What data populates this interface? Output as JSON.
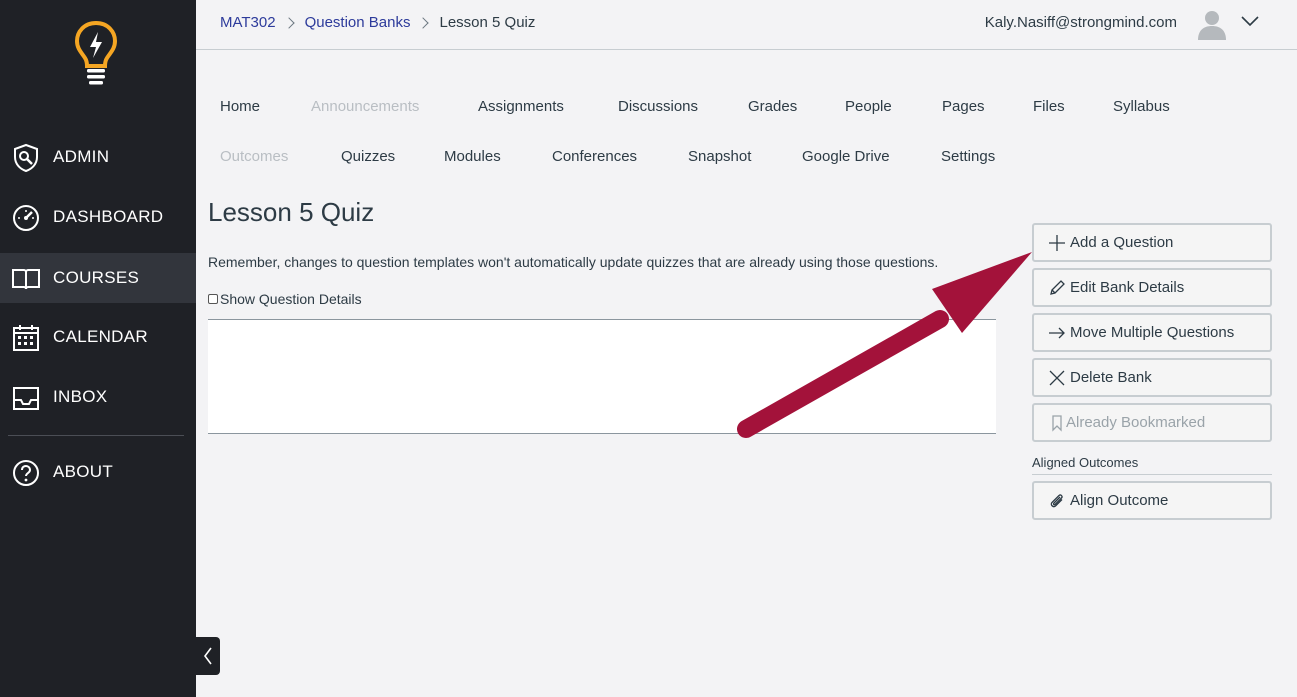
{
  "sidebar": {
    "items": [
      {
        "label": "ADMIN",
        "icon": "shield-wrench-icon"
      },
      {
        "label": "DASHBOARD",
        "icon": "speedometer-icon"
      },
      {
        "label": "COURSES",
        "icon": "book-icon"
      },
      {
        "label": "CALENDAR",
        "icon": "calendar-icon"
      },
      {
        "label": "INBOX",
        "icon": "inbox-icon"
      },
      {
        "label": "ABOUT",
        "icon": "question-circle-icon"
      }
    ],
    "active": "COURSES",
    "logo_color": "#f5a623"
  },
  "breadcrumb": {
    "items": [
      "MAT302",
      "Question Banks",
      "Lesson 5 Quiz"
    ]
  },
  "user": {
    "email": "Kaly.Nasiff@strongmind.com"
  },
  "course_nav": {
    "row1": [
      "Home",
      "Announcements",
      "Assignments",
      "Discussions",
      "Grades",
      "People",
      "Pages",
      "Files",
      "Syllabus"
    ],
    "row2": [
      "Outcomes",
      "Quizzes",
      "Modules",
      "Conferences",
      "Snapshot",
      "Google Drive",
      "Settings"
    ],
    "disabled": [
      "Announcements",
      "Outcomes"
    ]
  },
  "main": {
    "title": "Lesson 5 Quiz",
    "notice": "Remember, changes to question templates won't automatically update quizzes that are already using those questions.",
    "show_details_label": "Show Question Details"
  },
  "actions": {
    "add_question": "Add a Question",
    "edit_bank": "Edit Bank Details",
    "move_questions": "Move Multiple Questions",
    "delete_bank": "Delete Bank",
    "bookmarked": "Already Bookmarked",
    "aligned_outcomes_label": "Aligned Outcomes",
    "align_outcome": "Align Outcome"
  },
  "colors": {
    "sidebar_bg": "#1f2126",
    "link": "#2d3b9b",
    "arrow": "#a3123a"
  }
}
